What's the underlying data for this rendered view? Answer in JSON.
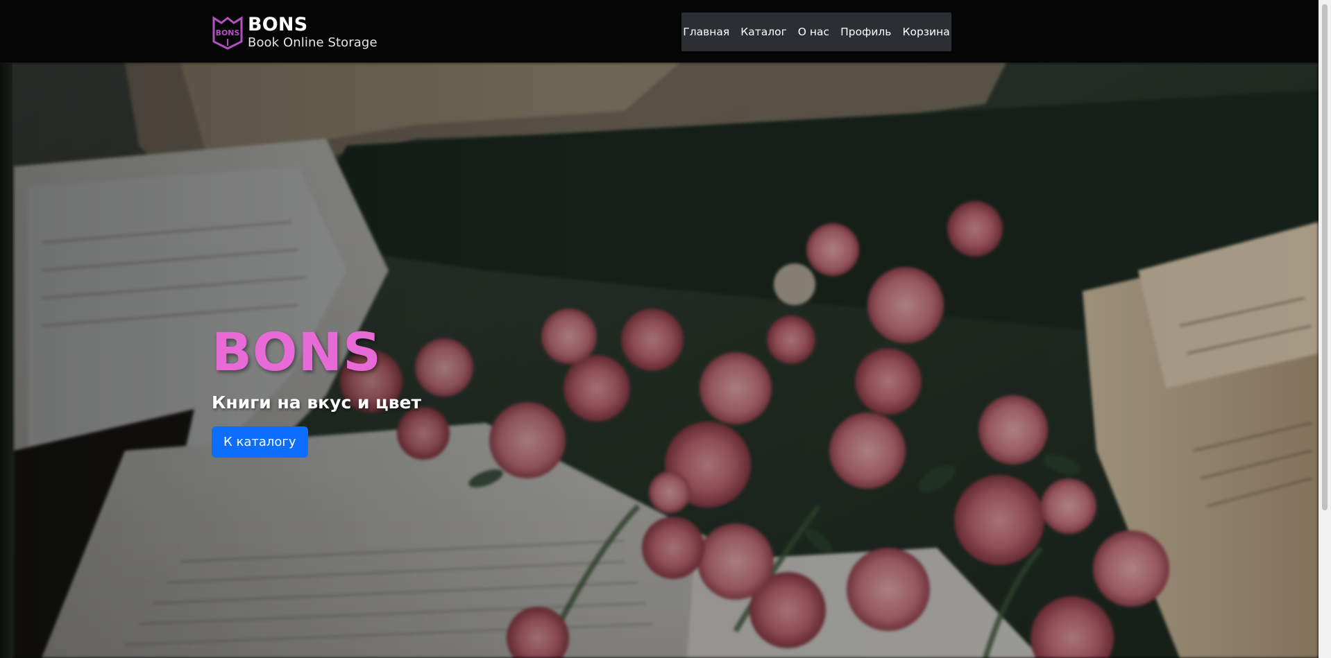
{
  "header": {
    "brand": {
      "name": "BONS",
      "subtitle": "Book Online Storage",
      "logo_text": "BONS",
      "logo_color": "#b44fc2"
    },
    "nav": [
      {
        "label": "Главная"
      },
      {
        "label": "Каталог"
      },
      {
        "label": "О нас"
      },
      {
        "label": "Профиль"
      },
      {
        "label": "Корзина"
      }
    ]
  },
  "hero": {
    "title": "BONS",
    "subtitle": "Книги на вкус и цвет",
    "button_label": "К каталогу",
    "background_image": "blurred open books with pink carnations",
    "title_color": "#e86ad6",
    "button_color": "#0d6efd"
  }
}
